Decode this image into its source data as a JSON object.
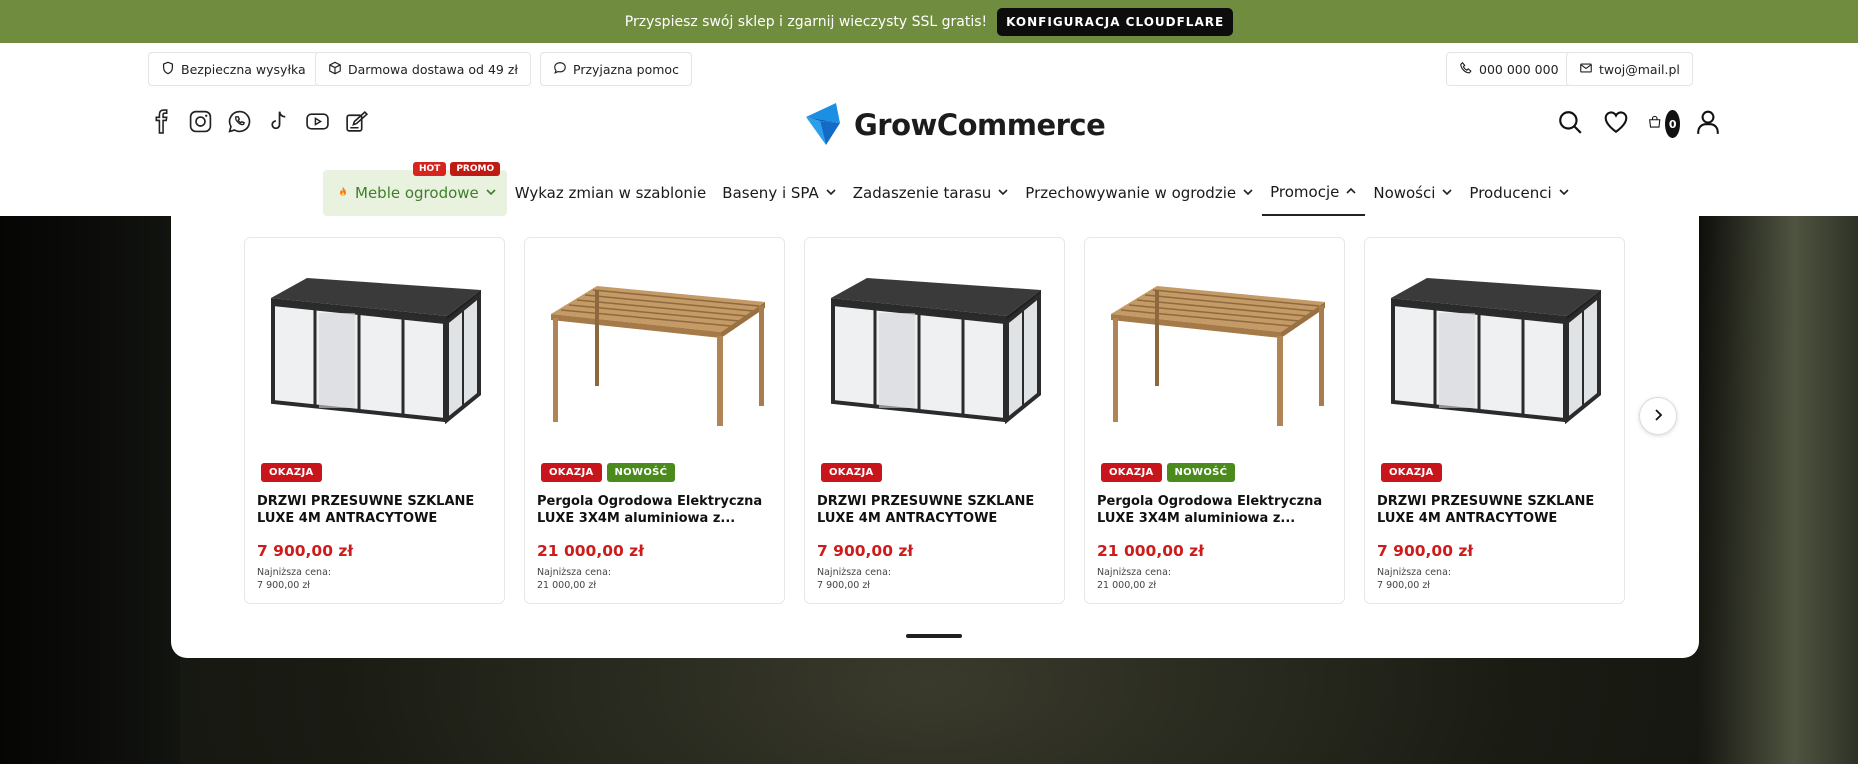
{
  "promo": {
    "text": "Przyspiesz swój sklep i zgarnij wieczysty SSL gratis!",
    "button": "KONFIGURACJA CLOUDFLARE"
  },
  "utility": {
    "left": [
      {
        "label": "Bezpieczna wysyłka",
        "icon": "shield-icon"
      },
      {
        "label": "Darmowa dostawa od 49 zł",
        "icon": "package-icon"
      },
      {
        "label": "Przyjazna pomoc",
        "icon": "chat-bubble-icon"
      }
    ],
    "phone": "000 000 000",
    "email": "twoj@mail.pl"
  },
  "social": [
    "facebook-icon",
    "instagram-icon",
    "whatsapp-icon",
    "tiktok-icon",
    "youtube-icon",
    "blog-icon"
  ],
  "logo": {
    "text": "GrowCommerce"
  },
  "header": {
    "cart_count": "0"
  },
  "nav": {
    "featured": {
      "label": "Meble ogrodowe",
      "badges": [
        "HOT",
        "PROMO"
      ]
    },
    "items": [
      {
        "label": "Wykaz zmian w szablonie"
      },
      {
        "label": "Baseny i SPA"
      },
      {
        "label": "Zadaszenie tarasu"
      },
      {
        "label": "Przechowywanie w ogrodzie"
      },
      {
        "label": "Promocje"
      },
      {
        "label": "Nowości"
      },
      {
        "label": "Producenci"
      }
    ]
  },
  "products": [
    {
      "badges": [
        "OKAZJA"
      ],
      "title": "DRZWI PRZESUWNE SZKLANE LUXE 4M ANTRACYTOWE",
      "price": "7 900,00 zł",
      "lowest_label": "Najniższa cena:",
      "lowest_price": "7 900,00 zł",
      "image": "glass-enclosure"
    },
    {
      "badges": [
        "OKAZJA",
        "NOWOŚĆ"
      ],
      "title": "Pergola Ogrodowa Elektryczna LUXE 3X4M aluminiowa z...",
      "price": "21 000,00 zł",
      "lowest_label": "Najniższa cena:",
      "lowest_price": "21 000,00 zł",
      "image": "wood-pergola"
    },
    {
      "badges": [
        "OKAZJA"
      ],
      "title": "DRZWI PRZESUWNE SZKLANE LUXE 4M ANTRACYTOWE",
      "price": "7 900,00 zł",
      "lowest_label": "Najniższa cena:",
      "lowest_price": "7 900,00 zł",
      "image": "glass-enclosure"
    },
    {
      "badges": [
        "OKAZJA",
        "NOWOŚĆ"
      ],
      "title": "Pergola Ogrodowa Elektryczna LUXE 3X4M aluminiowa z...",
      "price": "21 000,00 zł",
      "lowest_label": "Najniższa cena:",
      "lowest_price": "21 000,00 zł",
      "image": "wood-pergola"
    },
    {
      "badges": [
        "OKAZJA"
      ],
      "title": "DRZWI PRZESUWNE SZKLANE LUXE 4M ANTRACYTOWE",
      "price": "7 900,00 zł",
      "lowest_label": "Najniższa cena:",
      "lowest_price": "7 900,00 zł",
      "image": "glass-enclosure"
    }
  ],
  "colors": {
    "promo_bar": "#6f8c3f",
    "price": "#cc1c1c",
    "badge_okazja": "#c8151b",
    "badge_nowosc": "#4b8a1d",
    "brand_blue": "#1a8fe3"
  }
}
